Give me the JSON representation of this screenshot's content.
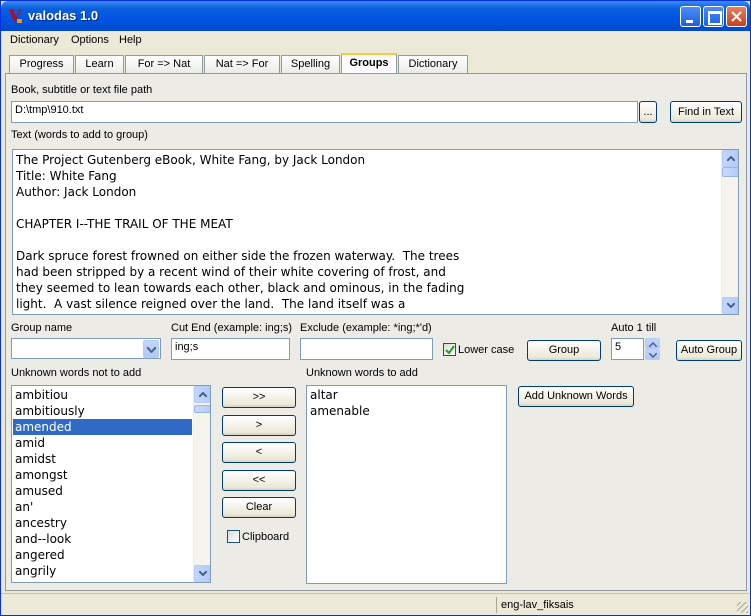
{
  "window": {
    "title": "valodas 1.0",
    "icon_letter": "V"
  },
  "menu": {
    "items": [
      "Dictionary",
      "Options",
      "Help"
    ]
  },
  "tabs": [
    "Progress",
    "Learn",
    "For => Nat",
    "Nat => For",
    "Spelling",
    "Groups",
    "Dictionary"
  ],
  "active_tab": "Groups",
  "book": {
    "label": "Book, subtitle or text file path",
    "path_value": "D:\\tmp\\910.txt",
    "browse_label": "...",
    "find_label": "Find in Text"
  },
  "text_area": {
    "label": "Text (words to add to group)",
    "lines": [
      "The Project Gutenberg eBook, White Fang, by Jack London",
      "Title: White Fang",
      "Author: Jack London",
      "",
      "CHAPTER I--THE TRAIL OF THE MEAT",
      "",
      "Dark spruce forest frowned on either side the frozen waterway.  The trees",
      "had been stripped by a recent wind of their white covering of frost, and",
      "they seemed to lean towards each other, black and ominous, in the fading",
      "light.  A vast silence reigned over the land.  The land itself was a"
    ]
  },
  "group": {
    "group_name_label": "Group name",
    "group_name_value": "",
    "cut_end_label": "Cut End (example: ing;s)",
    "cut_end_value": "ing;s",
    "exclude_label": "Exclude (example: *ing;*'d)",
    "exclude_value": "",
    "lower_case_label": "Lower case",
    "lower_case_checked": true,
    "group_button": "Group",
    "auto_label": "Auto 1 till",
    "auto_value": "5",
    "auto_group_button": "Auto Group"
  },
  "unknown_not_add": {
    "label": "Unknown words not to add",
    "items": [
      "ambitiou",
      "ambitiously",
      "amended",
      "amid",
      "amidst",
      "amongst",
      "amused",
      "an'",
      "ancestry",
      "and--look",
      "angered",
      "angrily"
    ],
    "selected": "amended"
  },
  "move_buttons": {
    "add_all": ">>",
    "add_one": ">",
    "remove_one": "<",
    "remove_all": "<<",
    "clear": "Clear",
    "clipboard_label": "Clipboard",
    "clipboard_checked": false
  },
  "unknown_to_add": {
    "label": "Unknown words to add",
    "items": [
      "altar",
      "amenable"
    ],
    "add_button": "Add Unknown Words"
  },
  "status": {
    "dictionary": "eng-lav_fiksais"
  }
}
